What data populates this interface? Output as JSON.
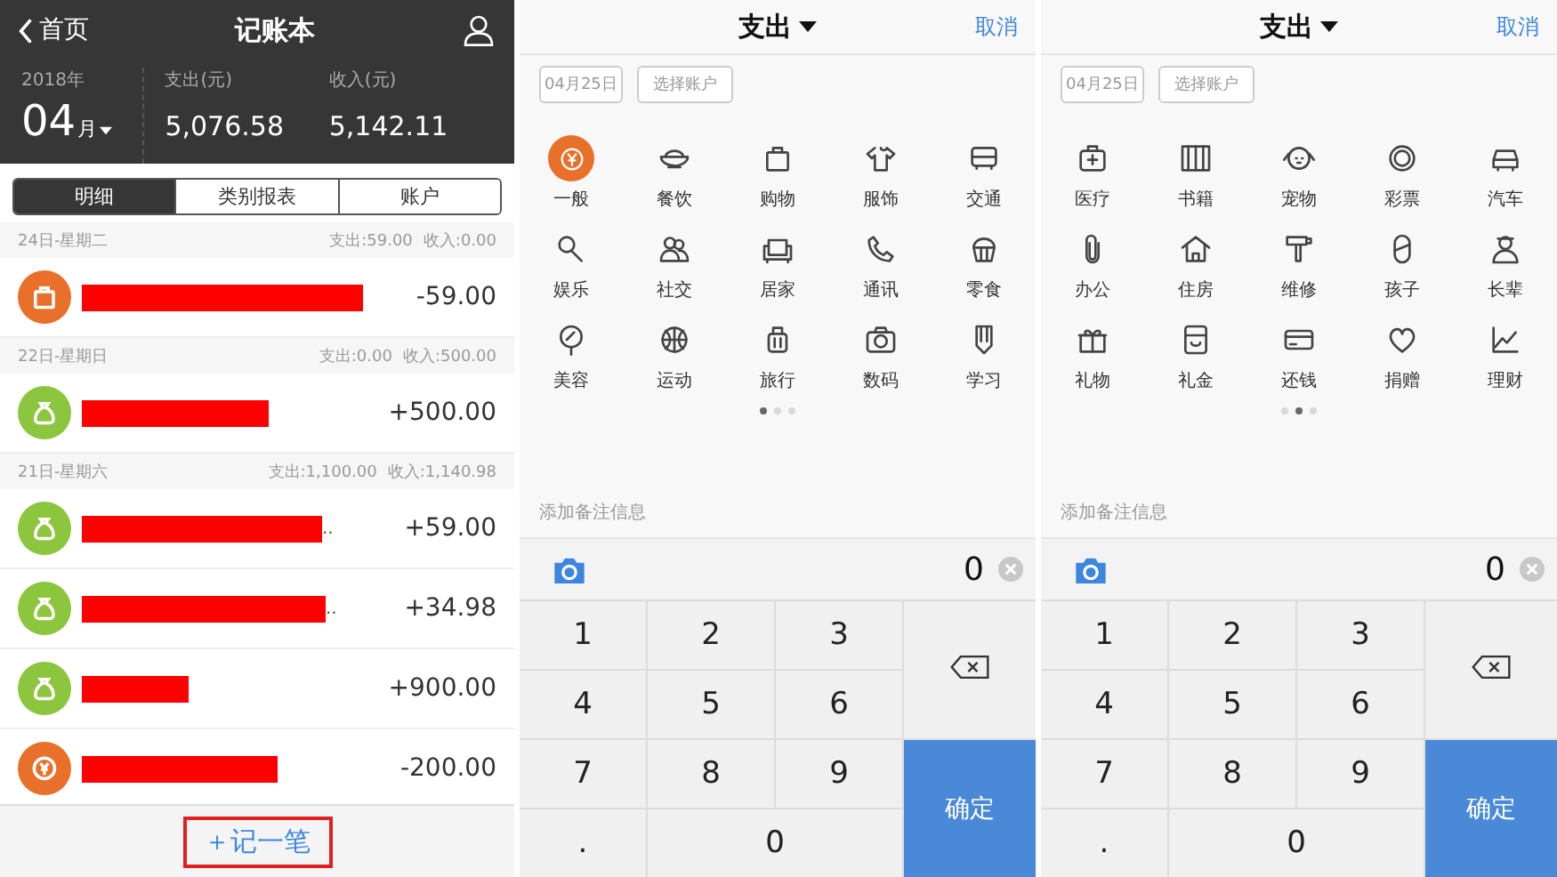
{
  "ledger": {
    "back": "首页",
    "title": "记账本",
    "year": "2018年",
    "month": "04",
    "month_unit": "月",
    "expense_label": "支出(元)",
    "expense": "5,076.58",
    "income_label": "收入(元)",
    "income": "5,142.11",
    "tabs": [
      {
        "label": "明细",
        "selected": true
      },
      {
        "label": "类别报表",
        "selected": false
      },
      {
        "label": "账户",
        "selected": false
      }
    ],
    "days": [
      {
        "date": "24日-星期二",
        "expense": "支出:59.00",
        "income": "收入:0.00",
        "entries": [
          {
            "kind": "shopping",
            "amount": "-59.00"
          }
        ]
      },
      {
        "date": "22日-星期日",
        "expense": "支出:0.00",
        "income": "收入:500.00",
        "entries": [
          {
            "kind": "income",
            "amount": "+500.00"
          }
        ]
      },
      {
        "date": "21日-星期六",
        "expense": "支出:1,100.00",
        "income": "收入:1,140.98",
        "entries": [
          {
            "kind": "income",
            "amount": "+59.00",
            "suffix": ".."
          },
          {
            "kind": "income",
            "amount": "+34.98",
            "suffix": ".."
          },
          {
            "kind": "income",
            "amount": "+900.00"
          },
          {
            "kind": "general",
            "amount": "-200.00"
          }
        ]
      }
    ],
    "add_button": "＋记一笔"
  },
  "entry_forms": [
    {
      "type_title": "支出",
      "cancel": "取消",
      "date": "04月25日",
      "account": "选择账户",
      "categories": [
        {
          "label": "一般",
          "selected": true
        },
        {
          "label": "餐饮",
          "selected": false
        },
        {
          "label": "购物",
          "selected": false
        },
        {
          "label": "服饰",
          "selected": false
        },
        {
          "label": "交通",
          "selected": false
        },
        {
          "label": "娱乐",
          "selected": false
        },
        {
          "label": "社交",
          "selected": false
        },
        {
          "label": "居家",
          "selected": false
        },
        {
          "label": "通讯",
          "selected": false
        },
        {
          "label": "零食",
          "selected": false
        },
        {
          "label": "美容",
          "selected": false
        },
        {
          "label": "运动",
          "selected": false
        },
        {
          "label": "旅行",
          "selected": false
        },
        {
          "label": "数码",
          "selected": false
        },
        {
          "label": "学习",
          "selected": false
        }
      ],
      "pages": [
        {
          "selected": true
        },
        {
          "selected": false
        },
        {
          "selected": false
        }
      ],
      "note_placeholder": "添加备注信息",
      "amount": "0",
      "keys": [
        "1",
        "2",
        "3",
        "4",
        "5",
        "6",
        "7",
        "8",
        "9",
        ".",
        "0"
      ],
      "confirm": "确定"
    },
    {
      "type_title": "支出",
      "cancel": "取消",
      "date": "04月25日",
      "account": "选择账户",
      "categories": [
        {
          "label": "医疗",
          "selected": false
        },
        {
          "label": "书籍",
          "selected": false
        },
        {
          "label": "宠物",
          "selected": false
        },
        {
          "label": "彩票",
          "selected": false
        },
        {
          "label": "汽车",
          "selected": false
        },
        {
          "label": "办公",
          "selected": false
        },
        {
          "label": "住房",
          "selected": false
        },
        {
          "label": "维修",
          "selected": false
        },
        {
          "label": "孩子",
          "selected": false
        },
        {
          "label": "长辈",
          "selected": false
        },
        {
          "label": "礼物",
          "selected": false
        },
        {
          "label": "礼金",
          "selected": false
        },
        {
          "label": "还钱",
          "selected": false
        },
        {
          "label": "捐赠",
          "selected": false
        },
        {
          "label": "理财",
          "selected": false
        }
      ],
      "pages": [
        {
          "selected": false
        },
        {
          "selected": true
        },
        {
          "selected": false
        }
      ],
      "note_placeholder": "添加备注信息",
      "amount": "0",
      "keys": [
        "1",
        "2",
        "3",
        "4",
        "5",
        "6",
        "7",
        "8",
        "9",
        ".",
        "0"
      ],
      "confirm": "确定"
    }
  ]
}
